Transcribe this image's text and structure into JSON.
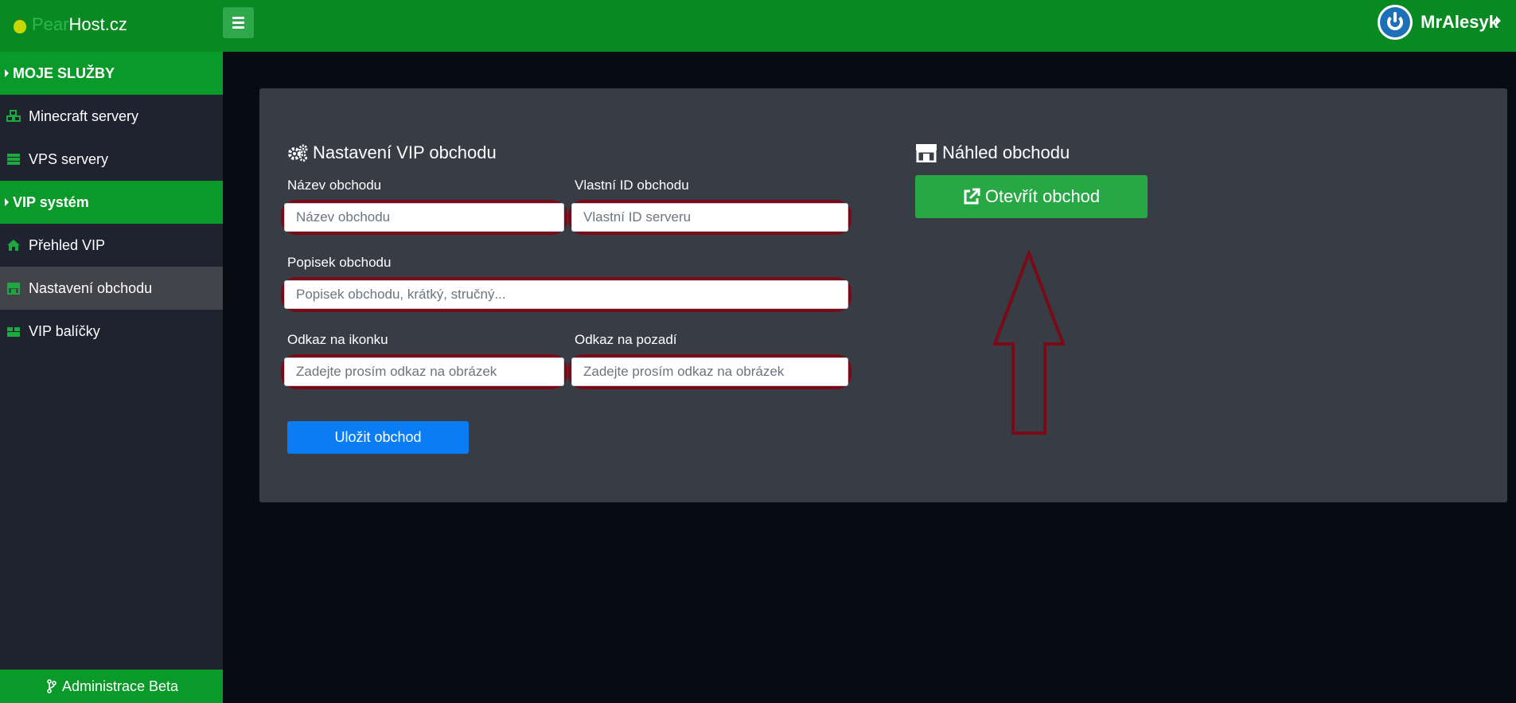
{
  "brand": {
    "pear": "Pear",
    "host": "Host.cz"
  },
  "user": {
    "name": "MrAlesyk"
  },
  "sidebar": {
    "sections": [
      {
        "label": "MOJE SLUŽBY"
      },
      {
        "label": "VIP systém"
      }
    ],
    "items": [
      {
        "label": "Minecraft servery",
        "icon": "cubes-icon"
      },
      {
        "label": "VPS servery",
        "icon": "server-icon"
      },
      {
        "label": "Přehled VIP",
        "icon": "home-icon"
      },
      {
        "label": "Nastavení obchodu",
        "icon": "store-icon",
        "active": true
      },
      {
        "label": "VIP balíčky",
        "icon": "boxes-icon"
      }
    ],
    "footer": "Administrace Beta"
  },
  "settings": {
    "title": "Nastavení VIP obchodu",
    "name_label": "Název obchodu",
    "name_placeholder": "Název obchodu",
    "id_label": "Vlastní ID obchodu",
    "id_placeholder": "Vlastní ID serveru",
    "desc_label": "Popisek obchodu",
    "desc_placeholder": "Popisek obchodu, krátký, stručný...",
    "icon_label": "Odkaz na ikonku",
    "icon_placeholder": "Zadejte prosím odkaz na obrázek",
    "bg_label": "Odkaz na pozadí",
    "bg_placeholder": "Zadejte prosím odkaz na obrázek",
    "save_label": "Uložit obchod"
  },
  "preview": {
    "title": "Náhled obchodu",
    "open_label": "Otevřít obchod"
  },
  "colors": {
    "topbar": "#088922",
    "sidebar_section": "#0a9a2a",
    "sidebar_bg": "#1f2330",
    "card_bg": "#383c45",
    "highlight": "#7a0a18",
    "primary": "#0a7cf4",
    "success": "#28a745"
  }
}
